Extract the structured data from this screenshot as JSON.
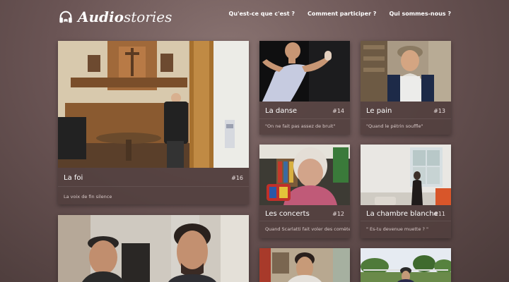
{
  "brand": {
    "name_bold": "Audio",
    "name_light": "stories"
  },
  "nav": [
    {
      "label": "Qu'est-ce que c'est ?"
    },
    {
      "label": "Comment participer ?"
    },
    {
      "label": "Qui sommes-nous ?"
    }
  ],
  "stories": [
    {
      "title": "La foi",
      "number": "#16",
      "subtitle": "La voix de fin silence"
    },
    {
      "title": "La danse",
      "number": "#14",
      "subtitle": "\"On ne fait pas assez de bruit\""
    },
    {
      "title": "Le pain",
      "number": "#13",
      "subtitle": "\"Quand le pétrin souffle\""
    },
    {
      "title": "Les concerts",
      "number": "#12",
      "subtitle": "Quand Scarlatti fait voler des comètes"
    },
    {
      "title": "La chambre blanche",
      "number": "#11",
      "subtitle": "\" Es-tu devenue muette ? \""
    }
  ],
  "icons": {
    "logo": "headphones-icon"
  }
}
